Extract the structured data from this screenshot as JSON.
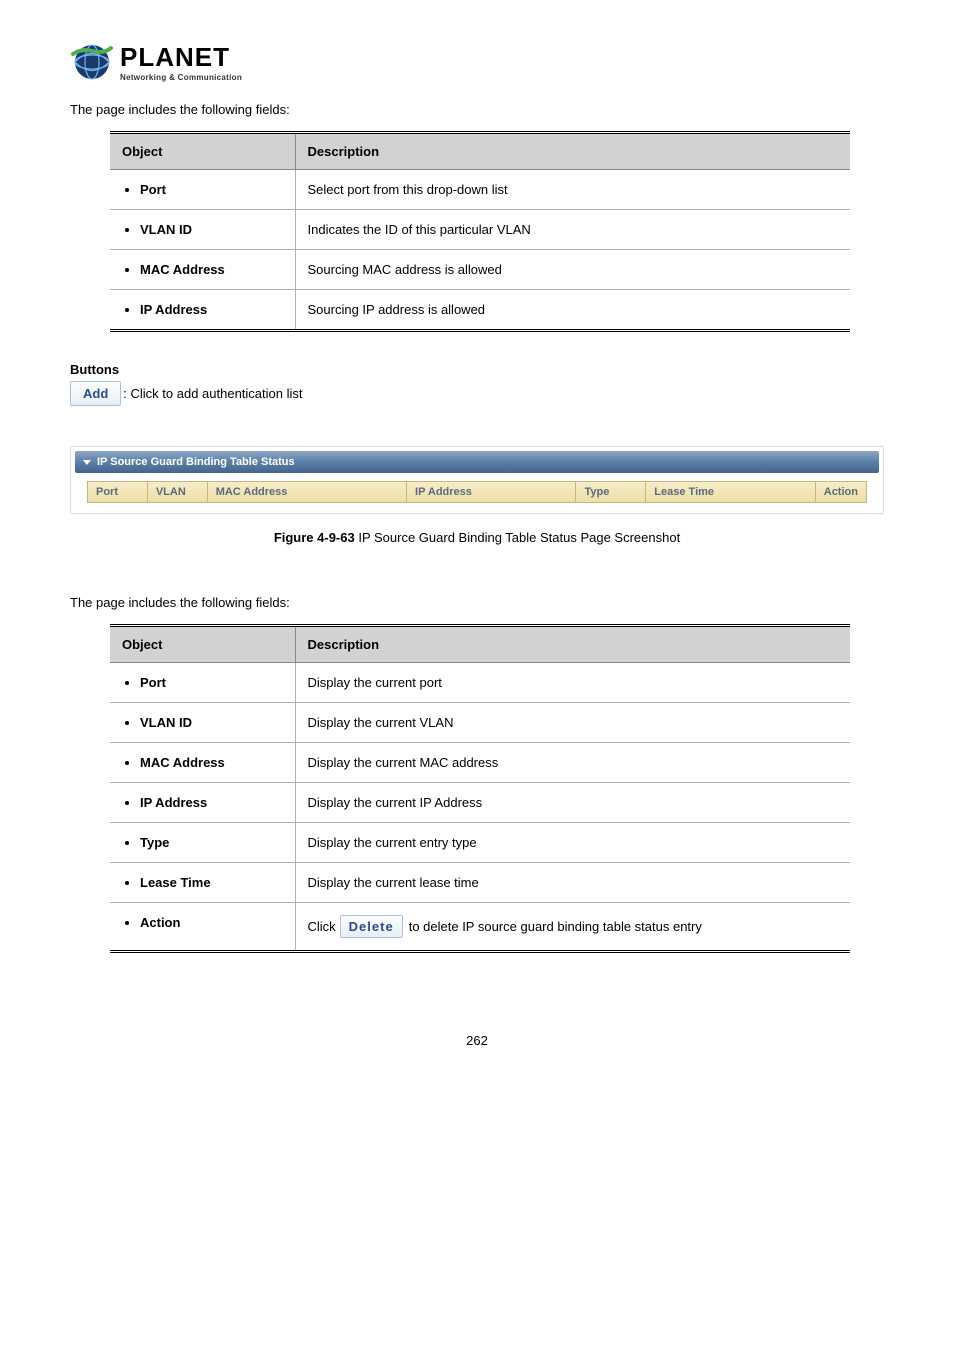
{
  "logo": {
    "name": "PLANET",
    "tagline": "Networking & Communication"
  },
  "intro1": "The page includes the following fields:",
  "table1": {
    "head_object": "Object",
    "head_desc": "Description",
    "rows": [
      {
        "obj": "Port",
        "desc": "Select port from this drop-down list"
      },
      {
        "obj": "VLAN ID",
        "desc": "Indicates the ID of this particular VLAN"
      },
      {
        "obj": "MAC Address",
        "desc": "Sourcing MAC address is allowed"
      },
      {
        "obj": "IP Address",
        "desc": "Sourcing IP address is allowed"
      }
    ]
  },
  "buttons_section": {
    "heading": "Buttons",
    "add_label": "Add",
    "add_text": ": Click to add authentication list"
  },
  "status_panel": {
    "title": "IP Source Guard Binding Table Status",
    "cols": {
      "port": "Port",
      "vlan": "VLAN",
      "mac": "MAC Address",
      "ip": "IP Address",
      "type": "Type",
      "lease": "Lease Time",
      "action": "Action"
    }
  },
  "figure": {
    "label": "Figure 4-9-63",
    "text": " IP Source Guard Binding Table Status Page Screenshot"
  },
  "intro2": "The page includes the following fields:",
  "table2": {
    "head_object": "Object",
    "head_desc": "Description",
    "rows": [
      {
        "obj": "Port",
        "desc": "Display the current port"
      },
      {
        "obj": "VLAN ID",
        "desc": "Display the current VLAN"
      },
      {
        "obj": "MAC Address",
        "desc": "Display the current MAC address"
      },
      {
        "obj": "IP Address",
        "desc": "Display the current IP Address"
      },
      {
        "obj": "Type",
        "desc": "Display the current entry type"
      },
      {
        "obj": "Lease Time",
        "desc": "Display the current lease time"
      }
    ],
    "action_row": {
      "obj": "Action",
      "pre": "Click ",
      "btn": "Delete",
      "post": " to delete IP source guard binding table status entry"
    }
  },
  "page_number": "262"
}
